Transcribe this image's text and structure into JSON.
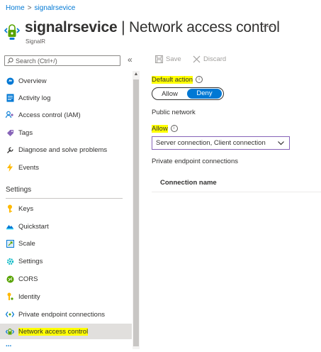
{
  "breadcrumb": {
    "home": "Home",
    "separator": ">",
    "resource": "signalrsevice"
  },
  "header": {
    "resource_name": "signalrsevice",
    "divider": " | ",
    "page_title": "Network access control",
    "more": "···",
    "subtitle": "SignalR"
  },
  "search": {
    "placeholder": "Search (Ctrl+/)",
    "collapse": "«"
  },
  "nav": {
    "top_items": [
      {
        "label": "Overview",
        "icon": "overview-icon"
      },
      {
        "label": "Activity log",
        "icon": "activity-log-icon"
      },
      {
        "label": "Access control (IAM)",
        "icon": "iam-icon"
      },
      {
        "label": "Tags",
        "icon": "tag-icon"
      },
      {
        "label": "Diagnose and solve problems",
        "icon": "wrench-icon"
      },
      {
        "label": "Events",
        "icon": "lightning-icon"
      }
    ],
    "section_settings": "Settings",
    "settings_items": [
      {
        "label": "Keys",
        "icon": "key-icon"
      },
      {
        "label": "Quickstart",
        "icon": "cloud-icon"
      },
      {
        "label": "Scale",
        "icon": "scale-icon"
      },
      {
        "label": "Settings",
        "icon": "gear-icon"
      },
      {
        "label": "CORS",
        "icon": "cors-icon"
      },
      {
        "label": "Identity",
        "icon": "identity-icon"
      },
      {
        "label": "Private endpoint connections",
        "icon": "endpoint-icon"
      },
      {
        "label": "Network access control",
        "icon": "network-icon"
      }
    ],
    "more": "..."
  },
  "toolbar": {
    "save_label": "Save",
    "discard_label": "Discard"
  },
  "main": {
    "default_action_label": "Default action",
    "info_glyph": "i",
    "toggle_allow": "Allow",
    "toggle_deny": "Deny",
    "toggle_selected": "Deny",
    "public_network_label": "Public network",
    "allow_label": "Allow",
    "allow_dropdown_value": "Server connection, Client connection",
    "private_endpoint_label": "Private endpoint connections",
    "column_connection_name": "Connection name"
  },
  "colors": {
    "accent": "#0078d4",
    "highlight": "#ffff00",
    "active_nav": "#e1dfdd"
  }
}
